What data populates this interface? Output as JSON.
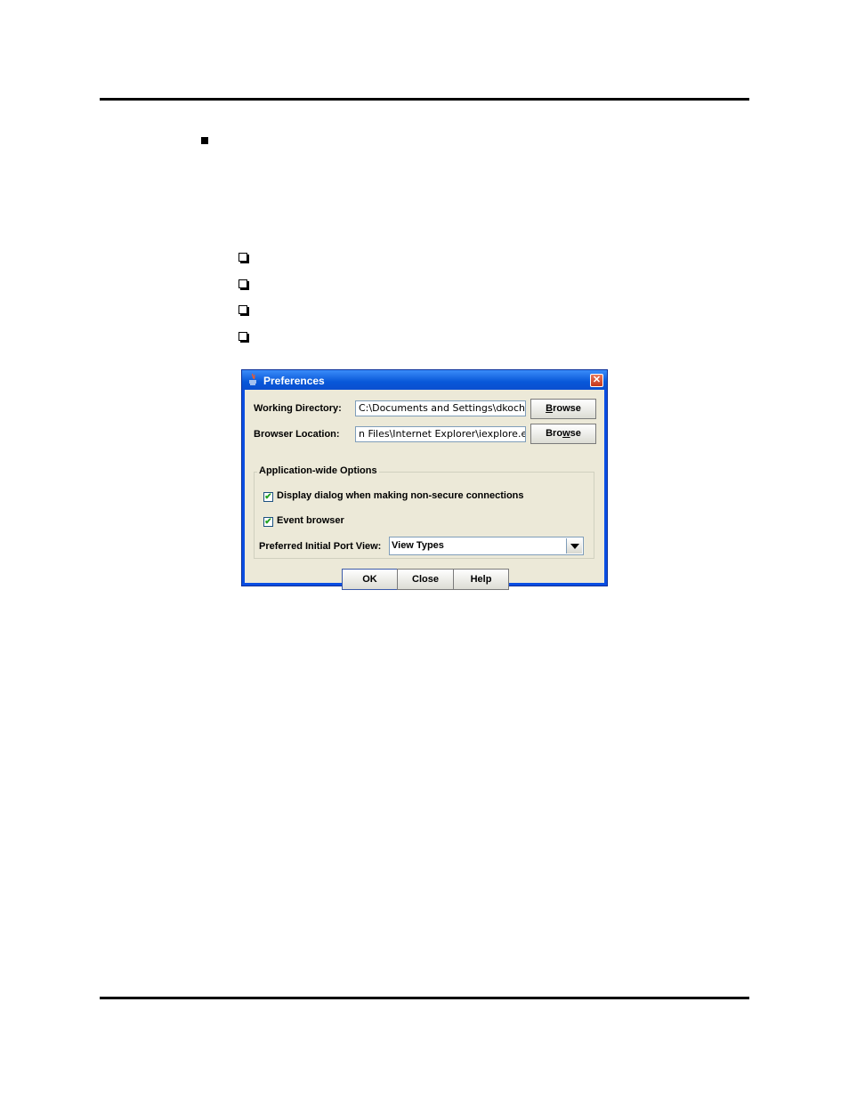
{
  "dialog": {
    "title": "Preferences",
    "working_directory": {
      "label": "Working Directory:",
      "value": "C:\\Documents and Settings\\dkoch",
      "browse_label_pre": "",
      "browse_label_u": "B",
      "browse_label_post": "rowse"
    },
    "browser_location": {
      "label": "Browser Location:",
      "value": "n Files\\Internet Explorer\\iexplore.exe",
      "browse_label_pre": "Bro",
      "browse_label_u": "w",
      "browse_label_post": "se"
    },
    "options_group": {
      "title": "Application-wide Options",
      "option1": {
        "label": "Display dialog when making non-secure connections",
        "checked": true
      },
      "option2": {
        "label": "Event browser",
        "checked": true
      },
      "port_view": {
        "label": "Preferred Initial Port View:",
        "value": "View Types"
      }
    },
    "buttons": {
      "ok": "OK",
      "close": "Close",
      "help": "Help"
    },
    "check_glyph": "✔",
    "close_glyph": "✕"
  }
}
